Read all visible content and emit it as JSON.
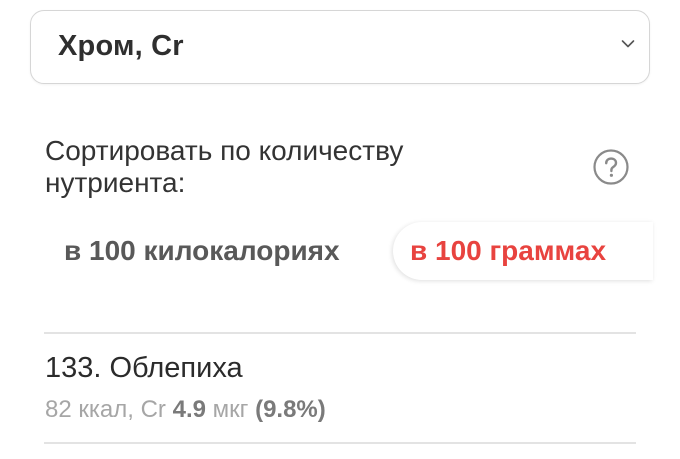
{
  "nutrient_select": {
    "value": "Хром, Cr"
  },
  "sort": {
    "label": "Сортировать по количеству нутриента:",
    "options": [
      {
        "label": "в 100 килокалориях",
        "selected": false
      },
      {
        "label": "в 100 граммах",
        "selected": true
      }
    ]
  },
  "icons": {
    "select_chevron": "chevron-down-icon",
    "help": "question-circle-icon"
  },
  "colors": {
    "accent": "#e8433f",
    "text": "#333333",
    "muted": "#a6a6a6"
  },
  "list": {
    "items": [
      {
        "rank_name": "133. Облепиха",
        "kcal": "82 ккал,",
        "nutrient_symbol": "Cr",
        "amount": "4.9",
        "unit": "мкг",
        "percent": "(9.8%)"
      }
    ]
  }
}
